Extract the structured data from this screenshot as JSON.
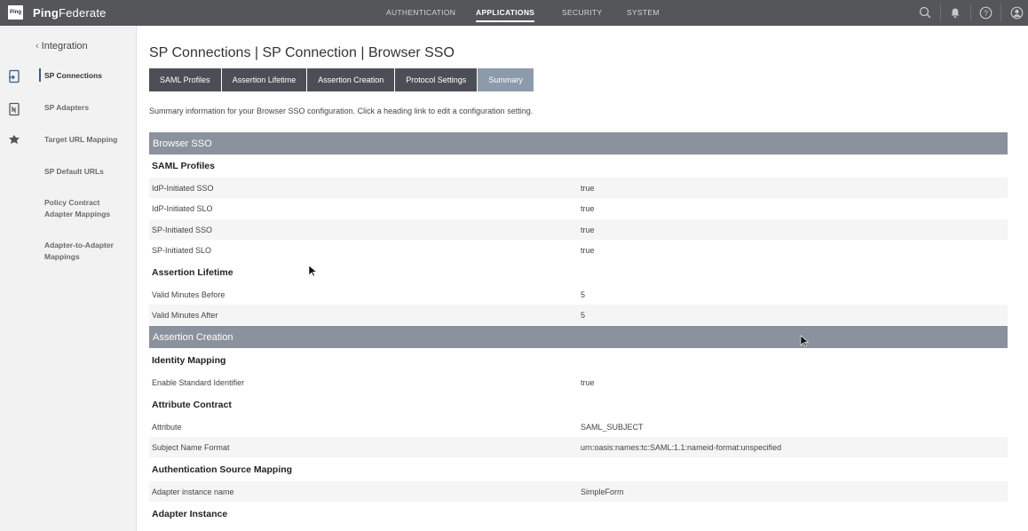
{
  "app": {
    "logo_mark": "Ping",
    "brand_bold": "Ping",
    "brand_rest": "Federate"
  },
  "topnav": [
    {
      "label": "AUTHENTICATION",
      "active": false
    },
    {
      "label": "APPLICATIONS",
      "active": true
    },
    {
      "label": "SECURITY",
      "active": false
    },
    {
      "label": "SYSTEM",
      "active": false
    }
  ],
  "top_icons": [
    "search-icon",
    "bell-icon",
    "help-icon",
    "user-icon"
  ],
  "sidebar": {
    "back_label": "Integration",
    "items": [
      {
        "label": "SP Connections",
        "active": true,
        "icon": "sp-connections-icon"
      },
      {
        "label": "SP Adapters",
        "active": false,
        "icon": "sp-adapters-icon"
      },
      {
        "label": "Target URL Mapping",
        "active": false,
        "icon": "target-mapping-icon"
      },
      {
        "label": "SP Default URLs",
        "active": false
      },
      {
        "label": "Policy Contract Adapter Mappings",
        "active": false
      },
      {
        "label": "Adapter-to-Adapter Mappings",
        "active": false
      }
    ]
  },
  "main": {
    "title": "SP Connections | SP Connection | Browser SSO",
    "tabs": [
      {
        "label": "SAML Profiles",
        "active": false
      },
      {
        "label": "Assertion Lifetime",
        "active": false
      },
      {
        "label": "Assertion Creation",
        "active": false
      },
      {
        "label": "Protocol Settings",
        "active": false
      },
      {
        "label": "Summary",
        "active": true
      }
    ],
    "intro": "Summary information for your Browser SSO configuration. Click a heading link to edit a configuration setting.",
    "sections": {
      "browser_sso": "Browser SSO",
      "saml_profiles": "SAML Profiles",
      "assertion_lifetime": "Assertion Lifetime",
      "assertion_creation": "Assertion Creation",
      "identity_mapping": "Identity Mapping",
      "attribute_contract": "Attribute Contract",
      "auth_source_mapping": "Authentication Source Mapping",
      "adapter_instance": "Adapter Instance"
    },
    "rows": {
      "idp_sso": {
        "key": "IdP-Initiated SSO",
        "value": "true"
      },
      "idp_slo": {
        "key": "IdP-Initiated SLO",
        "value": "true"
      },
      "sp_sso": {
        "key": "SP-Initiated SSO",
        "value": "true"
      },
      "sp_slo": {
        "key": "SP-Initiated SLO",
        "value": "true"
      },
      "min_before": {
        "key": "Valid Minutes Before",
        "value": "5"
      },
      "min_after": {
        "key": "Valid Minutes After",
        "value": "5"
      },
      "std_identifier": {
        "key": "Enable Standard Identifier",
        "value": "true"
      },
      "attribute": {
        "key": "Attribute",
        "value": "SAML_SUBJECT"
      },
      "name_format": {
        "key": "Subject Name Format",
        "value": "urn:oasis:names:tc:SAML:1.1:nameid-format:unspecified"
      },
      "adapter_name": {
        "key": "Adapter instance name",
        "value": "SimpleForm"
      }
    }
  },
  "colors": {
    "topbar": "#545659",
    "tab": "#4b4f55",
    "tab_active": "#8c9aac",
    "section_bar": "#8c929d",
    "sidebar_bg": "#f2f2f2"
  }
}
